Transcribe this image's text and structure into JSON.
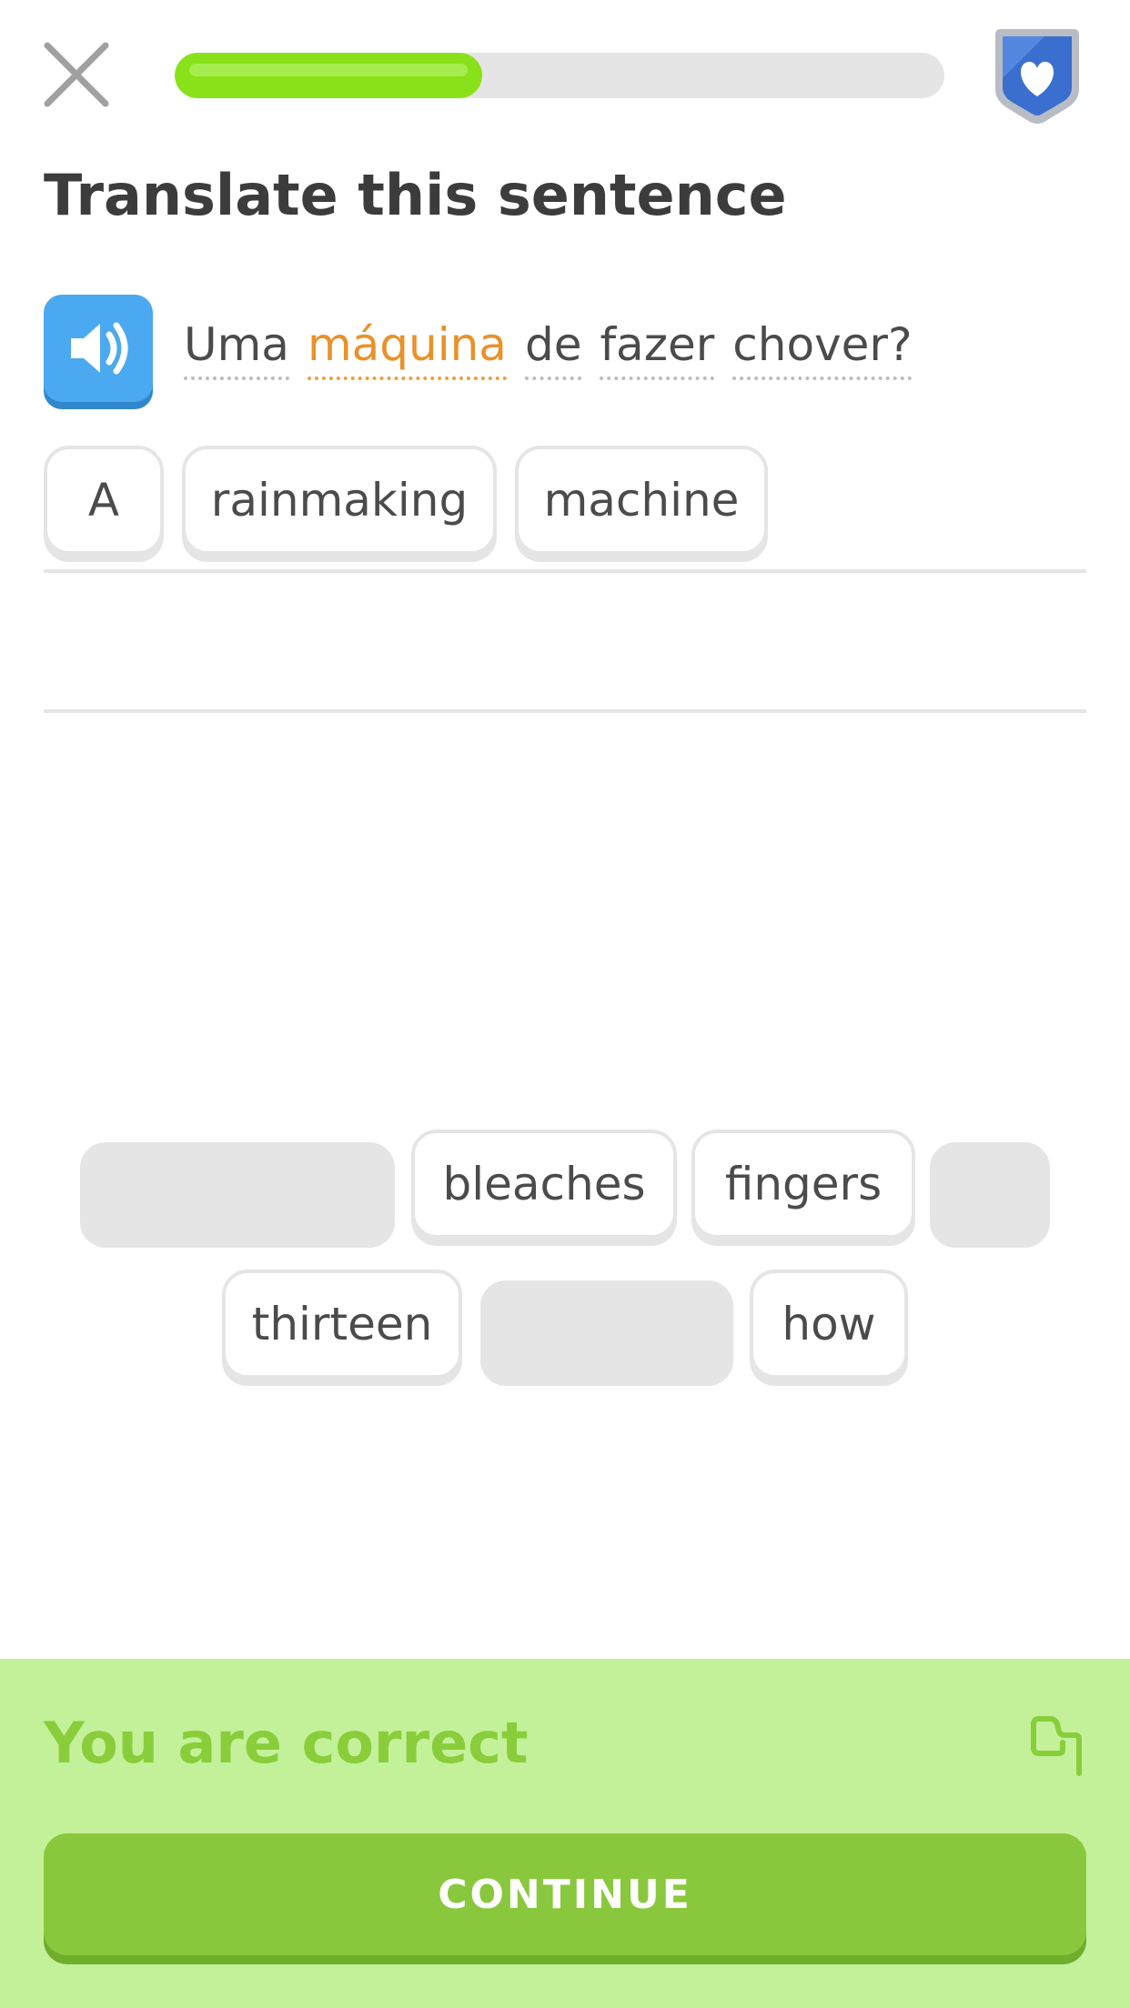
{
  "header": {
    "progress_fraction": 0.4,
    "close_icon": "close-icon",
    "hearts_icon": "heart-shield-icon"
  },
  "exercise": {
    "title": "Translate this sentence",
    "audio_icon": "speaker-icon",
    "prompt_words": [
      "Uma",
      "máquina",
      "de",
      "fazer",
      "chover?"
    ],
    "highlighted_word": "máquina"
  },
  "answer": {
    "selected_words": [
      "A",
      "rainmaking",
      "machine"
    ]
  },
  "word_bank": {
    "row1": [
      "bleaches",
      "fingers"
    ],
    "row2": [
      "thirteen",
      "how"
    ]
  },
  "feedback": {
    "message": "You are correct",
    "flag_icon": "flag-icon",
    "continue_label": "CONTINUE"
  },
  "colors": {
    "progress": "#89e219",
    "correct_bg": "#c2f19a",
    "correct_text": "#8acd3b",
    "continue_button": "#89c83c",
    "speaker_button": "#4aa9f0",
    "new_word": "#e8922b"
  }
}
